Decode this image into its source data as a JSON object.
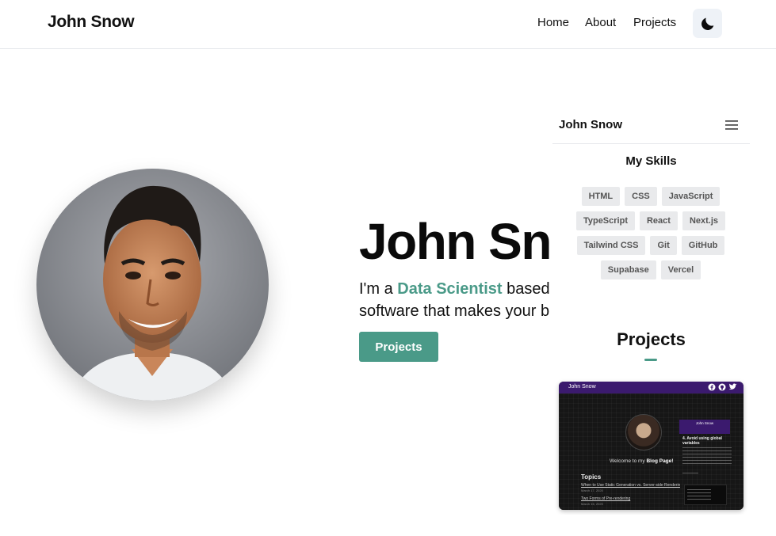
{
  "header": {
    "brand": "John Snow",
    "nav": [
      "Home",
      "About",
      "Projects"
    ],
    "theme_icon": "moon-icon"
  },
  "hero": {
    "name": "John Snow",
    "tagline_prefix": "I'm a ",
    "role": "Data Scientist",
    "tagline_suffix": " based",
    "tagline_line2": "software that makes your b",
    "button_label": "Projects",
    "accent": "#4a9a88"
  },
  "preview": {
    "brand": "John Snow",
    "menu_icon": "hamburger-menu-icon",
    "skills_title": "My Skills",
    "skills": [
      "HTML",
      "CSS",
      "JavaScript",
      "TypeScript",
      "React",
      "Next.js",
      "Tailwind CSS",
      "Git",
      "GitHub",
      "Supabase",
      "Vercel"
    ],
    "projects_title": "Projects",
    "card": {
      "brand": "John Snow",
      "icons": [
        "facebook-icon",
        "github-icon",
        "twitter-icon"
      ],
      "welcome_prefix": "Welcome to my ",
      "welcome_bold": "Blog Page!",
      "topics_title": "Topics",
      "link1": "When to Use Static Generation vs. Server-side Rendering",
      "date1": "March 17, 2020",
      "link2": "Two Forms of Pre-rendering",
      "date2": "March 16, 2020",
      "side_brand": "John Snow",
      "side_heading": "4. Avoid using global variables"
    }
  }
}
